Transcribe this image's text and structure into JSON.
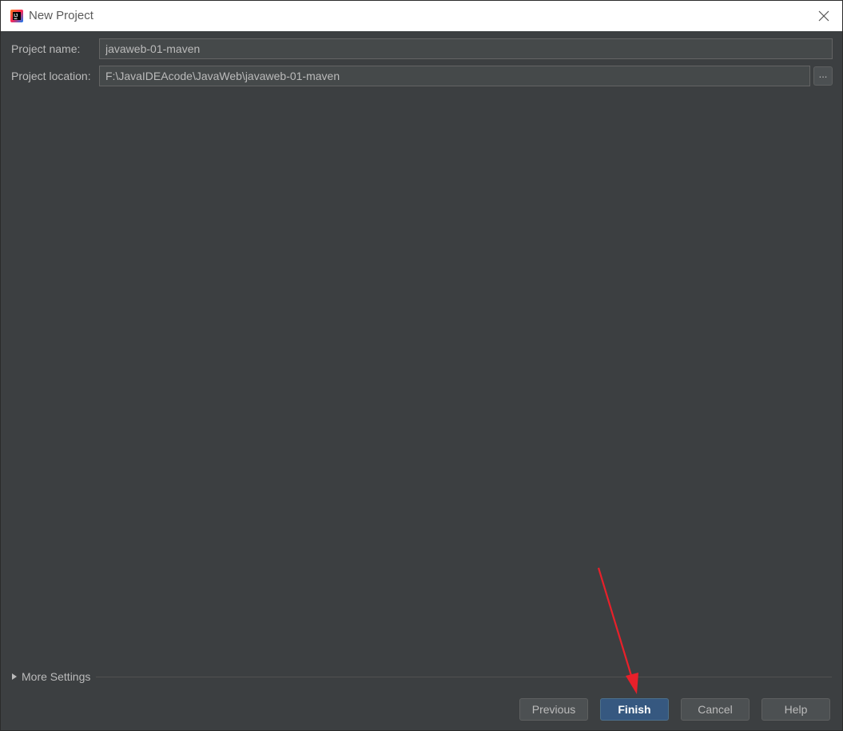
{
  "window": {
    "title": "New Project"
  },
  "form": {
    "project_name_label": "Project name:",
    "project_name_value": "javaweb-01-maven",
    "project_location_label": "Project location:",
    "project_location_value": "F:\\JavaIDEAcode\\JavaWeb\\javaweb-01-maven",
    "browse_label": "..."
  },
  "more_settings": {
    "label": "More Settings"
  },
  "buttons": {
    "previous": "Previous",
    "finish": "Finish",
    "cancel": "Cancel",
    "help": "Help"
  },
  "icons": {
    "app": "intellij-idea-icon",
    "close": "close-icon",
    "expand": "triangle-right-icon"
  },
  "colors": {
    "background": "#3c3f41",
    "primary_button": "#365880",
    "annotation_arrow": "#e8202a"
  }
}
